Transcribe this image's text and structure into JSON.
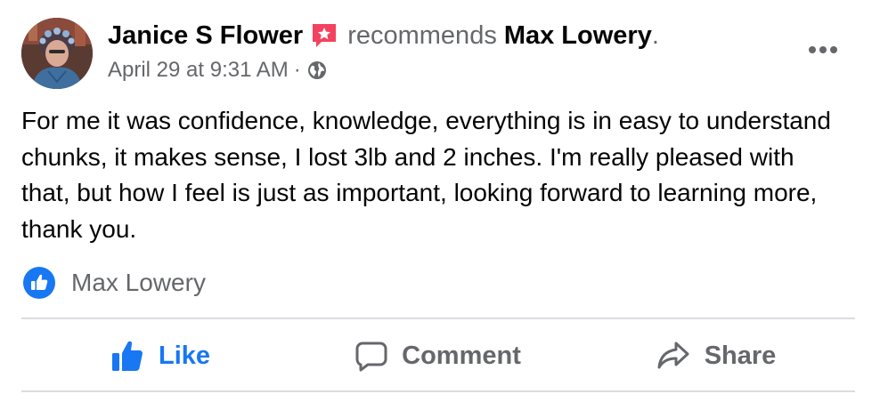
{
  "post": {
    "author": "Janice S Flower",
    "recommends_text": "recommends",
    "page_name": "Max Lowery",
    "period": ".",
    "timestamp": "April 29 at 9:31 AM",
    "meta_separator": "·",
    "body": "For me it was confidence, knowledge, everything is in easy to understand chunks, it makes sense, I lost 3lb and 2 inches. I'm really pleased with that, but how I feel is just as important, looking forward to learning more, thank you.",
    "icons": {
      "recommendation": "recommendation-star-icon",
      "audience": "globe-icon",
      "more": "more-options-icon",
      "reaction": "like-reaction-icon"
    }
  },
  "reactions": {
    "names": "Max Lowery"
  },
  "actions": [
    {
      "label": "Like",
      "icon": "thumbs-up-icon",
      "active": true
    },
    {
      "label": "Comment",
      "icon": "comment-icon",
      "active": false
    },
    {
      "label": "Share",
      "icon": "share-icon",
      "active": false
    }
  ],
  "colors": {
    "accent": "#1877f2",
    "secondary_text": "#65676b",
    "primary_text": "#050505",
    "recommend_badge": "#f3425f",
    "divider": "#dadde1"
  }
}
